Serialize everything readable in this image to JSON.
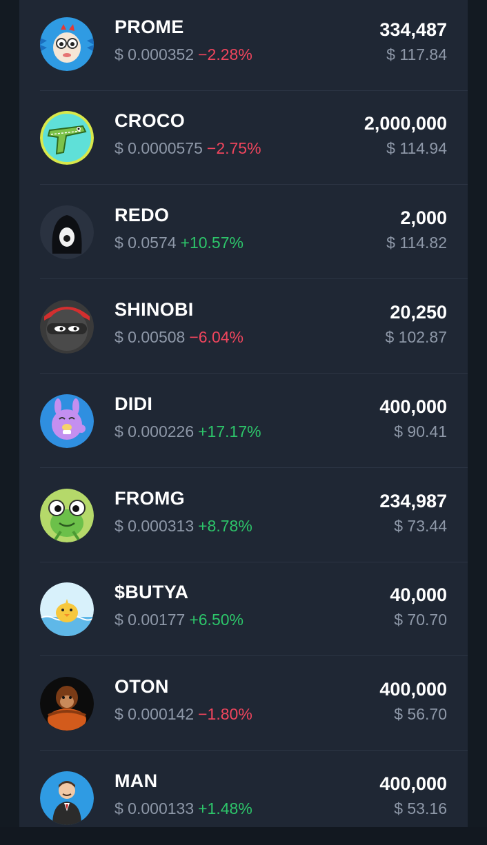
{
  "tokens": [
    {
      "symbol": "PROME",
      "price": "$ 0.000352",
      "change": "−2.28%",
      "direction": "negative",
      "amount": "334,487",
      "value": "$ 117.84",
      "icon": "prome-avatar-icon"
    },
    {
      "symbol": "CROCO",
      "price": "$ 0.0000575",
      "change": "−2.75%",
      "direction": "negative",
      "amount": "2,000,000",
      "value": "$ 114.94",
      "icon": "croco-avatar-icon"
    },
    {
      "symbol": "REDO",
      "price": "$ 0.0574",
      "change": "+10.57%",
      "direction": "positive",
      "amount": "2,000",
      "value": "$ 114.82",
      "icon": "redo-avatar-icon"
    },
    {
      "symbol": "SHINOBI",
      "price": "$ 0.00508",
      "change": "−6.04%",
      "direction": "negative",
      "amount": "20,250",
      "value": "$ 102.87",
      "icon": "shinobi-avatar-icon"
    },
    {
      "symbol": "DIDI",
      "price": "$ 0.000226",
      "change": "+17.17%",
      "direction": "positive",
      "amount": "400,000",
      "value": "$ 90.41",
      "icon": "didi-avatar-icon"
    },
    {
      "symbol": "FROMG",
      "price": "$ 0.000313",
      "change": "+8.78%",
      "direction": "positive",
      "amount": "234,987",
      "value": "$ 73.44",
      "icon": "fromg-avatar-icon"
    },
    {
      "symbol": "$BUTYA",
      "price": "$ 0.00177",
      "change": "+6.50%",
      "direction": "positive",
      "amount": "40,000",
      "value": "$ 70.70",
      "icon": "butya-avatar-icon"
    },
    {
      "symbol": "OTON",
      "price": "$ 0.000142",
      "change": "−1.80%",
      "direction": "negative",
      "amount": "400,000",
      "value": "$ 56.70",
      "icon": "oton-avatar-icon"
    },
    {
      "symbol": "MAN",
      "price": "$ 0.000133",
      "change": "+1.48%",
      "direction": "positive",
      "amount": "400,000",
      "value": "$ 53.16",
      "icon": "man-avatar-icon"
    }
  ],
  "colors": {
    "background": "#131a22",
    "panel": "#1f2734",
    "negative": "#f0455d",
    "positive": "#2dc56a",
    "muted": "#8e98a8"
  }
}
